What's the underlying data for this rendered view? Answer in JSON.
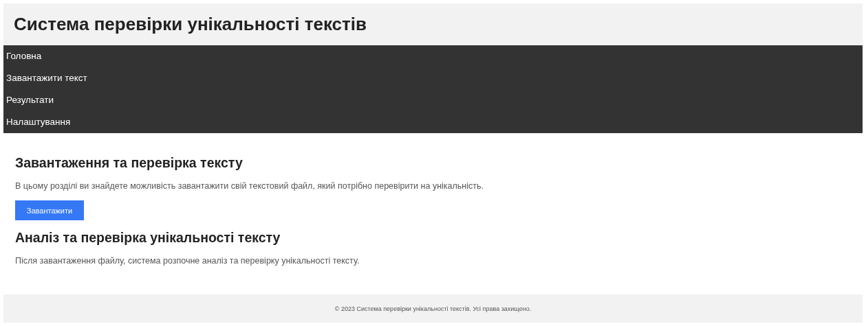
{
  "header": {
    "title": "Система перевірки унікальності текстів"
  },
  "nav": {
    "items": [
      {
        "label": "Головна"
      },
      {
        "label": "Завантажити текст"
      },
      {
        "label": "Результати"
      },
      {
        "label": "Налаштування"
      }
    ]
  },
  "sections": [
    {
      "heading": "Завантаження та перевірка тексту",
      "text": "В цьому розділі ви знайдете можливість завантажити свій текстовий файл, який потрібно перевірити на унікальність.",
      "button": "Завантажити"
    },
    {
      "heading": "Аналіз та перевірка унікальності тексту",
      "text": "Після завантаження файлу, система розпочне аналіз та перевірку унікальності тексту."
    }
  ],
  "footer": {
    "text": "© 2023 Система перевірки унікальності текстів. Усі права захищено."
  }
}
